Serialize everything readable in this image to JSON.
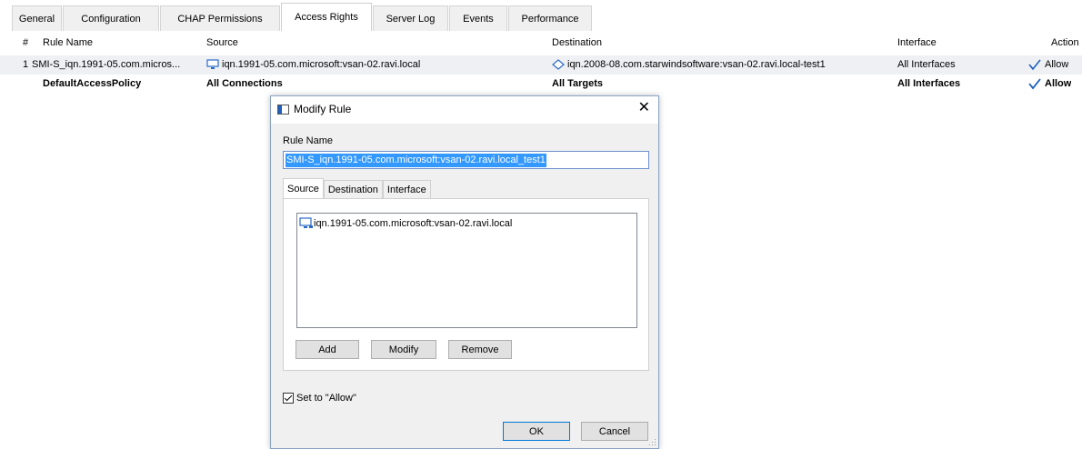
{
  "tabs": [
    {
      "label": "General"
    },
    {
      "label": "Configuration"
    },
    {
      "label": "CHAP Permissions"
    },
    {
      "label": "Access Rights",
      "active": true
    },
    {
      "label": "Server Log"
    },
    {
      "label": "Events"
    },
    {
      "label": "Performance"
    }
  ],
  "table": {
    "headers": {
      "num": "#",
      "rule_name": "Rule Name",
      "source": "Source",
      "destination": "Destination",
      "interface": "Interface",
      "action": "Action"
    },
    "rows": [
      {
        "num": "1",
        "rule_name": "SMI-S_iqn.1991-05.com.micros...",
        "source": "iqn.1991-05.com.microsoft:vsan-02.ravi.local",
        "destination": "iqn.2008-08.com.starwindsoftware:vsan-02.ravi.local-test1",
        "interface": "All Interfaces",
        "action": "Allow"
      },
      {
        "num": "",
        "rule_name": "DefaultAccessPolicy",
        "source": "All Connections",
        "destination": "All Targets",
        "interface": "All Interfaces",
        "action": "Allow"
      }
    ]
  },
  "dialog": {
    "title": "Modify Rule",
    "rule_name_label": "Rule Name",
    "rule_name_value": "SMI-S_iqn.1991-05.com.microsoft:vsan-02.ravi.local_test1",
    "tabs": [
      "Source",
      "Destination",
      "Interface"
    ],
    "source_items": [
      "iqn.1991-05.com.microsoft:vsan-02.ravi.local"
    ],
    "add_label": "Add",
    "modify_label": "Modify",
    "remove_label": "Remove",
    "allow_label": "Set to \"Allow\"",
    "allow_checked": true,
    "ok_label": "OK",
    "cancel_label": "Cancel"
  },
  "icons": {
    "source_icon": "computer-network-icon",
    "destination_icon": "target-diamond-icon",
    "allow_icon": "checkmark-icon",
    "dialog_icon": "window-icon",
    "close_icon": "close-icon"
  },
  "colors": {
    "accent": "#3399ff",
    "selected_row": "#eef0f4",
    "allow_check": "#1f5fbf"
  }
}
